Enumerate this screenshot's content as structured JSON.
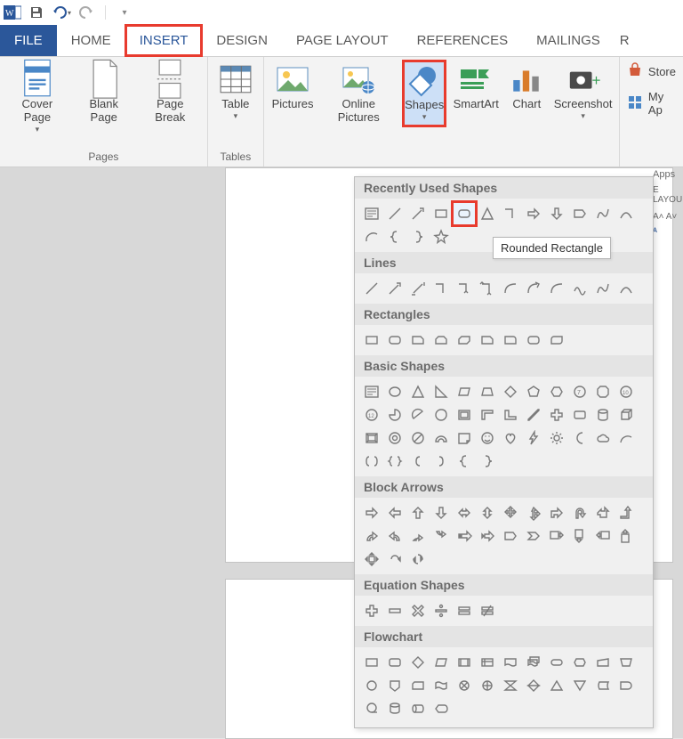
{
  "qat": {
    "save": "save-icon",
    "undo": "undo-icon",
    "redo": "redo-icon"
  },
  "tabs": {
    "file": "FILE",
    "home": "HOME",
    "insert": "INSERT",
    "design": "DESIGN",
    "pageLayout": "PAGE LAYOUT",
    "references": "REFERENCES",
    "mailings": "MAILINGS",
    "more": "R"
  },
  "ribbon": {
    "pages": {
      "label": "Pages",
      "coverPage": "Cover Page",
      "blankPage": "Blank Page",
      "pageBreak": "Page Break"
    },
    "tables": {
      "label": "Tables",
      "table": "Table"
    },
    "illustrations": {
      "pictures": "Pictures",
      "onlinePictures": "Online Pictures",
      "shapes": "Shapes",
      "smartArt": "SmartArt",
      "chart": "Chart",
      "screenshot": "Screenshot"
    },
    "addins": {
      "store": "Store",
      "myApps": "My Ap"
    }
  },
  "tooltip": "Rounded Rectangle",
  "rightClipped": {
    "apps": "Apps",
    "layout": "E LAYOU"
  },
  "shapesPanel": {
    "categories": [
      {
        "name": "Recently Used Shapes",
        "rows": 2,
        "items": [
          "text-box",
          "line",
          "line-arrow",
          "rectangle",
          "rounded-rectangle",
          "isoceles-tri",
          "elbow",
          "right-arrow",
          "down-arrow",
          "pentagon",
          "freeform",
          "curve",
          "arc",
          "left-brace",
          "right-brace",
          "star"
        ]
      },
      {
        "name": "Lines",
        "rows": 1,
        "items": [
          "line",
          "line-arrow",
          "double-arrow",
          "elbow",
          "elbow-arrow",
          "elbow-double",
          "curve-conn",
          "curve-arrow",
          "curve-double",
          "scribble",
          "freeform",
          "curve"
        ]
      },
      {
        "name": "Rectangles",
        "rows": 1,
        "items": [
          "rectangle",
          "rounded-rectangle",
          "snip-single",
          "snip-same",
          "snip-diag",
          "snip-round",
          "round-single",
          "round-same",
          "round-diag"
        ]
      },
      {
        "name": "Basic Shapes",
        "rows": 4,
        "items": [
          "text-box",
          "oval",
          "triangle",
          "right-tri",
          "parallelogram",
          "trapezoid",
          "diamond",
          "pentagon-reg",
          "hexagon",
          "heptagon",
          "octagon",
          "decagon",
          "dodecagon",
          "pie",
          "chord",
          "teardrop",
          "frame",
          "half-frame",
          "l-shape",
          "diag-stripe",
          "plus",
          "plaque",
          "can",
          "cube",
          "bevel",
          "donut",
          "no-symbol",
          "block-arc",
          "folded",
          "smiley",
          "heart",
          "lightning",
          "sun",
          "moon",
          "cloud",
          "arc2",
          "double-bracket",
          "double-brace",
          "left-bracket",
          "right-bracket",
          "left-brace",
          "right-brace"
        ]
      },
      {
        "name": "Block Arrows",
        "rows": 3,
        "items": [
          "right-arrow",
          "left-arrow",
          "up-arrow",
          "down-arrow",
          "left-right",
          "up-down",
          "quad",
          "three",
          "bent",
          "uturn",
          "left-up",
          "bent-up",
          "curve-right",
          "curve-left",
          "curve-up",
          "curve-down",
          "striped",
          "notched",
          "home-plate",
          "chevron",
          "callout-r",
          "callout-d",
          "callout-l",
          "callout-u",
          "quad-callout",
          "circular",
          "spin"
        ]
      },
      {
        "name": "Equation Shapes",
        "rows": 1,
        "items": [
          "plus",
          "minus",
          "multiply",
          "division",
          "equal",
          "not-equal"
        ]
      },
      {
        "name": "Flowchart",
        "rows": 3,
        "items": [
          "process",
          "alt-process",
          "decision",
          "data",
          "predefined",
          "internal",
          "document",
          "multidoc",
          "terminator",
          "prep",
          "manual-input",
          "manual-op",
          "connector",
          "offpage",
          "card",
          "tape",
          "junction",
          "or",
          "collate",
          "sort",
          "extract",
          "merge",
          "stored",
          "delay",
          "seq-access",
          "magnetic",
          "direct",
          "display"
        ]
      }
    ],
    "highlightCategory": 0,
    "highlightIndex": 4
  }
}
